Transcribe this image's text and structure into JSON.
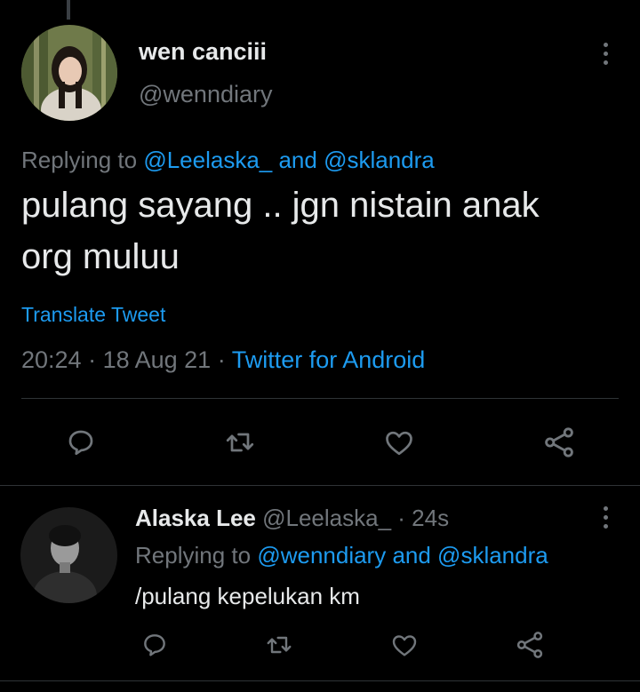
{
  "main_tweet": {
    "author_name": "wen canciii",
    "author_handle": "@wenndiary",
    "replying_prefix": "Replying to ",
    "reply_target_1": "@Leelaska_",
    "reply_and": " and ",
    "reply_target_2": "@sklandra",
    "text_line1": "pulang sayang .. jgn nistain anak",
    "text_line2": "org muluu",
    "translate_label": "Translate Tweet",
    "time": "20:24",
    "sep1": " · ",
    "date": "18 Aug 21",
    "sep2": " · ",
    "source": "Twitter for Android"
  },
  "reply_tweet": {
    "author_name": "Alaska Lee",
    "author_handle": "@Leelaska_",
    "time_ago": " · 24s",
    "replying_prefix": "Replying to ",
    "reply_target_1": "@wenndiary",
    "reply_and": " and ",
    "reply_target_2": "@sklandra",
    "text": "/pulang kepelukan km"
  },
  "icons": [
    "reply-icon",
    "retweet-icon",
    "like-icon",
    "share-icon",
    "more-icon"
  ],
  "colors": {
    "background": "#000000",
    "text": "#e7e9ea",
    "muted": "#71767b",
    "link": "#1d9bf0",
    "divider": "#2f3336"
  }
}
